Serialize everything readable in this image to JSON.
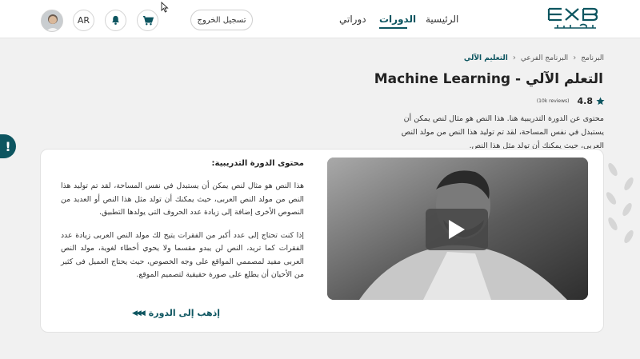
{
  "header": {
    "logo_alt": "إكساب",
    "nav": [
      {
        "label": "الرئيسية",
        "active": false
      },
      {
        "label": "الدورات",
        "active": true
      },
      {
        "label": "دوراتي",
        "active": false
      }
    ],
    "logout_label": "تسجيل الخروج",
    "lang_label": "AR",
    "cart_icon": "cart-icon",
    "bell_icon": "bell-icon"
  },
  "help": {
    "label": "!"
  },
  "breadcrumb": {
    "items": [
      "البرنامج",
      "البرنامج الفرعي",
      "التعليم الآلي"
    ]
  },
  "course": {
    "title": "التعلم الآلي - Machine Learning",
    "rating": "4.8",
    "reviews": "(10k reviews)",
    "description": "محتوى عن الدورة التدريبية هنا. هذا النص هو مثال لنص يمكن أن يستبدل في نفس المساحة، لقد تم توليد هذا النص من مولد النص العربى، حيث يمكنك أن تولد مثل هذا النص."
  },
  "card": {
    "heading": "محتوى الدورة التدريبية:",
    "paragraph1": "هذا النص هو مثال لنص يمكن أن يستبدل في نفس المساحة، لقد تم توليد هذا النص من مولد النص العربى، حيث يمكنك أن تولد مثل هذا النص أو العديد من النصوص الأخرى إضافة إلى زيادة عدد الحروف التى يولدها التطبيق.",
    "paragraph2": "إذا كنت تحتاج إلى عدد أكبر من الفقرات يتيح لك مولد النص العربى زيادة عدد الفقرات كما تريد، النص لن يبدو مقسما ولا يحوي أخطاء لغوية، مولد النص العربى مفيد لمصممي المواقع على وجه الخصوص، حيث يحتاج العميل فى كثير من الأحيان أن يطلع على صورة حقيقية لتصميم الموقع.",
    "go_label": "إذهب إلى الدورة",
    "go_arrows": "◀◀◀"
  },
  "colors": {
    "brand": "#0d5560",
    "background": "#f1f1f1",
    "star": "#0d5560"
  }
}
